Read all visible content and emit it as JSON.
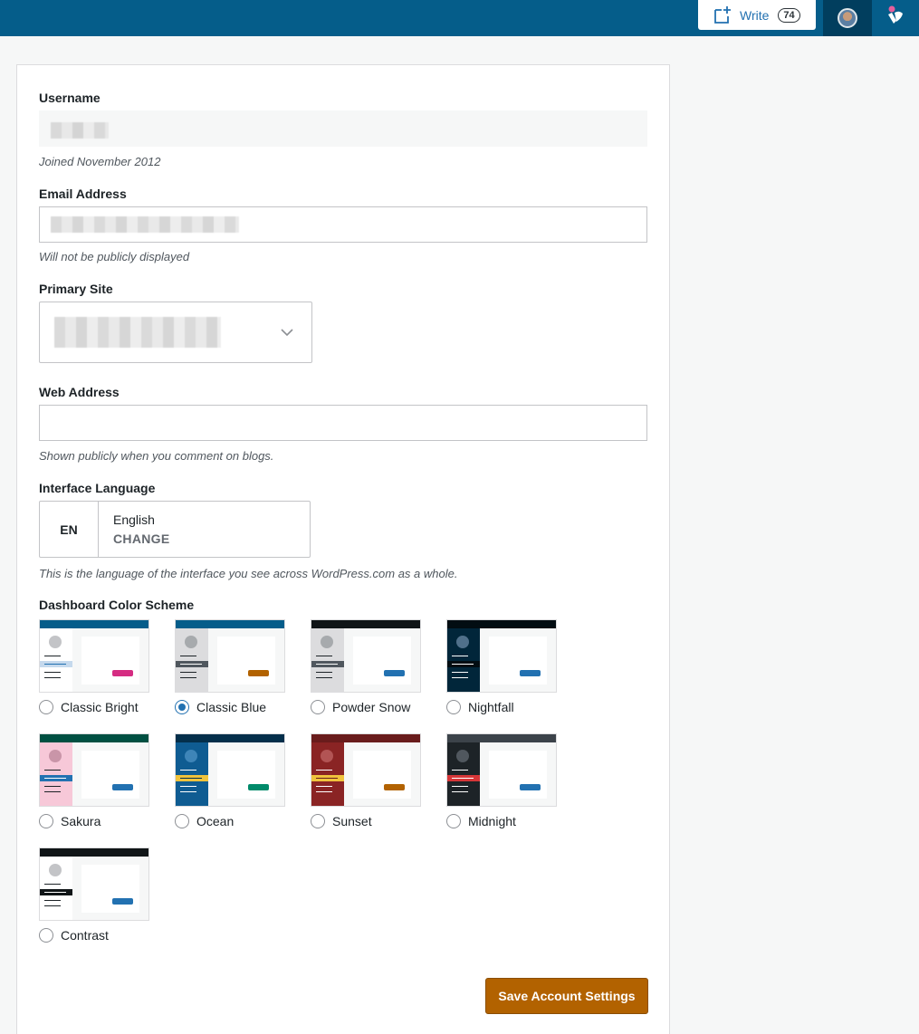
{
  "masterbar": {
    "write_label": "Write",
    "write_count": "74"
  },
  "form": {
    "username": {
      "label": "Username",
      "value": "",
      "help": "Joined November 2012"
    },
    "email": {
      "label": "Email Address",
      "value": "",
      "help": "Will not be publicly displayed"
    },
    "primary_site": {
      "label": "Primary Site",
      "value": ""
    },
    "web_address": {
      "label": "Web Address",
      "value": "",
      "help": "Shown publicly when you comment on blogs."
    },
    "language": {
      "label": "Interface Language",
      "code": "EN",
      "name": "English",
      "change": "CHANGE",
      "help": "This is the language of the interface you see across WordPress.com as a whole."
    },
    "color_scheme": {
      "label": "Dashboard Color Scheme",
      "selected": "Classic Blue",
      "options": [
        {
          "name": "Classic Bright",
          "bar": "#055d8a",
          "side": "#ffffff",
          "hl": "#c5d9ed",
          "hl_line": "#2271b1",
          "avatar": "#c3c4c7",
          "line": "#1d2327",
          "btn": "#d52c82"
        },
        {
          "name": "Classic Blue",
          "bar": "#055d8a",
          "side": "#dcdcde",
          "hl": "#50575e",
          "hl_line": "#ffffff",
          "avatar": "#a7aaad",
          "line": "#1d2327",
          "btn": "#b26200"
        },
        {
          "name": "Powder Snow",
          "bar": "#101517",
          "side": "#dcdcde",
          "hl": "#50575e",
          "hl_line": "#ffffff",
          "avatar": "#a7aaad",
          "line": "#1d2327",
          "btn": "#2271b1"
        },
        {
          "name": "Nightfall",
          "bar": "#020d12",
          "side": "#01263a",
          "hl": "#020d12",
          "hl_line": "#ffffff",
          "avatar": "#50708a",
          "line": "#ffffff",
          "btn": "#2271b1"
        },
        {
          "name": "Sakura",
          "bar": "#005042",
          "side": "#f7c8d8",
          "hl": "#2271b1",
          "hl_line": "#ffffff",
          "avatar": "#c995a8",
          "line": "#1d2327",
          "btn": "#2271b1"
        },
        {
          "name": "Ocean",
          "bar": "#042f4b",
          "side": "#0f5c92",
          "hl": "#f0c33c",
          "hl_line": "#042f4b",
          "avatar": "#3e85b8",
          "line": "#ffffff",
          "btn": "#008a6a"
        },
        {
          "name": "Sunset",
          "bar": "#691c1c",
          "side": "#8a2424",
          "hl": "#f0c33c",
          "hl_line": "#691c1c",
          "avatar": "#b25454",
          "line": "#ffffff",
          "btn": "#b26200"
        },
        {
          "name": "Midnight",
          "bar": "#3c434a",
          "side": "#1d2327",
          "hl": "#d63638",
          "hl_line": "#ffffff",
          "avatar": "#50575e",
          "line": "#ffffff",
          "btn": "#2271b1"
        },
        {
          "name": "Contrast",
          "bar": "#101517",
          "side": "#ffffff",
          "hl": "#101517",
          "hl_line": "#ffffff",
          "avatar": "#c3c4c7",
          "line": "#1d2327",
          "btn": "#2271b1"
        }
      ]
    },
    "save_label": "Save Account Settings"
  }
}
